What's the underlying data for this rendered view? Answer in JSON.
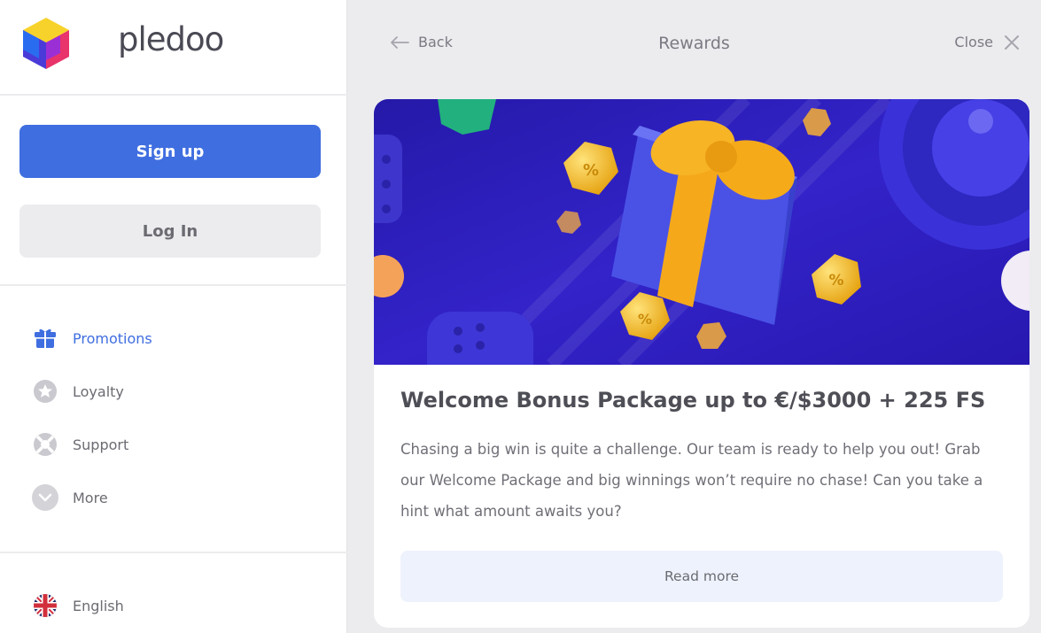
{
  "brand": {
    "name": "pledoo"
  },
  "auth": {
    "signup_label": "Sign up",
    "login_label": "Log In"
  },
  "nav": {
    "items": [
      {
        "label": "Promotions",
        "icon": "gift-icon",
        "active": true
      },
      {
        "label": "Loyalty",
        "icon": "star-icon",
        "active": false
      },
      {
        "label": "Support",
        "icon": "lifebuoy-icon",
        "active": false
      },
      {
        "label": "More",
        "icon": "chevron-down-icon",
        "active": false
      }
    ]
  },
  "language": {
    "label": "English",
    "icon": "uk-flag-icon"
  },
  "header": {
    "back_label": "Back",
    "title": "Rewards",
    "close_label": "Close"
  },
  "promo": {
    "title": "Welcome Bonus Package up to €/$3000 + 225 FS",
    "description": "Chasing a big win is quite a challenge. Our team is ready to help you out! Grab our Welcome Package and big winnings won’t require no chase! Can you take a hint what amount awaits you?",
    "button_label": "Read more",
    "coin_symbol": "%"
  },
  "colors": {
    "accent": "#3f6ee0",
    "banner_bg": "#2a1fb8",
    "gift_blue": "#4a52e6",
    "ribbon_gold": "#f5b21c"
  }
}
